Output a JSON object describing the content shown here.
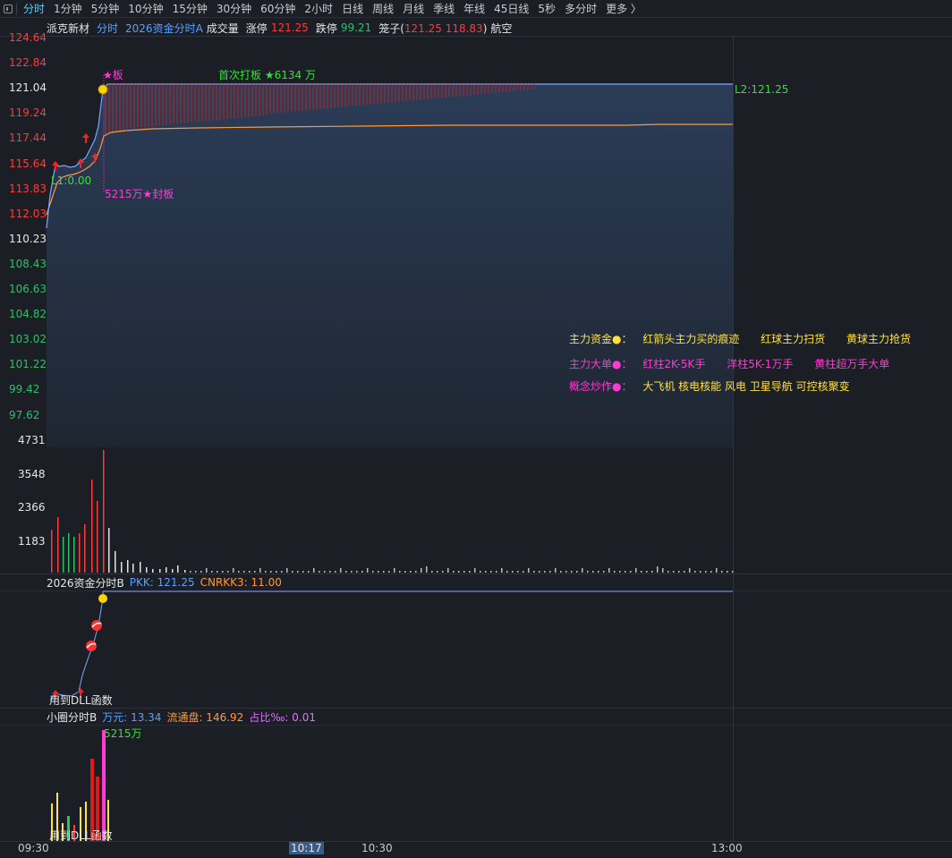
{
  "toolbar": {
    "items": [
      "分时",
      "1分钟",
      "5分钟",
      "10分钟",
      "15分钟",
      "30分钟",
      "60分钟",
      "2小时",
      "日线",
      "周线",
      "月线",
      "季线",
      "年线",
      "45日线",
      "5秒",
      "多分时",
      "更多 〉"
    ],
    "active_index": 0
  },
  "info": {
    "stock_name": "派克新材",
    "mode": "分时",
    "indicator_a": "2026资金分时A",
    "volume_label": "成交量",
    "limit_up_label": "涨停",
    "limit_up_value": "121.25",
    "limit_down_label": "跌停",
    "limit_down_value": "99.21",
    "cage_label": "笼子(",
    "cage_v1": "121.25",
    "cage_v2": "118.83",
    "cage_close": ")",
    "sector": "航空"
  },
  "price_axis": {
    "labels": [
      "124.64",
      "122.84",
      "121.04",
      "119.24",
      "117.44",
      "115.64",
      "113.83",
      "112.03",
      "110.23",
      "108.43",
      "106.63",
      "104.82",
      "103.02",
      "101.22",
      "99.42",
      "97.62"
    ],
    "colors": [
      "red",
      "red",
      "white",
      "red",
      "red",
      "red",
      "red",
      "red",
      "white",
      "green",
      "green",
      "green",
      "green",
      "green",
      "green",
      "green"
    ]
  },
  "volume_axis": {
    "labels": [
      "4731",
      "3548",
      "2366",
      "1183"
    ]
  },
  "annotations": {
    "board_star": "★板",
    "first_board": "首次打板 ★6134 万",
    "seal_board": "5215万★封板",
    "l1_label": "L1:0.00",
    "l2_label": "L2:121.25"
  },
  "legend": {
    "row1": {
      "title": "主力资金●：",
      "a": "红箭头主力买的痕迹",
      "b": "红球主力扫货",
      "c": "黄球主力抢货"
    },
    "row2": {
      "title": "主力大单●：",
      "a": "红柱2K-5K手",
      "b": "洋柱5K-1万手",
      "c": "黄柱超万手大单"
    },
    "row3": {
      "title": "概念炒作●：",
      "a": "大飞机 核电核能 风电 卫星导航 可控核聚变"
    }
  },
  "panel_b": {
    "title": "2026资金分时B",
    "pkk": "PKK: 121.25",
    "cnrkk": "CNRKK3: 11.00",
    "dll_text": "用到DLL函数"
  },
  "panel_c": {
    "title": "小圈分时B",
    "wanyuan": "万元: 13.34",
    "float": "流通盘: 146.92",
    "ratio": "占比‰: 0.01",
    "top_bar_label": "5215万",
    "dll_text": "用到DLL函数"
  },
  "time_axis": {
    "labels": [
      "09:30",
      "10:17",
      "10:30",
      "13:00"
    ],
    "highlight": "10:17"
  },
  "colors": {
    "price_line": "#7aa7ff",
    "avg_line": "#ff9a3c",
    "fill": "#2a3b55",
    "red": "#ff3b3b",
    "green": "#2fc06a",
    "yellow": "#ffe23a",
    "magenta": "#ff3bd4"
  }
}
